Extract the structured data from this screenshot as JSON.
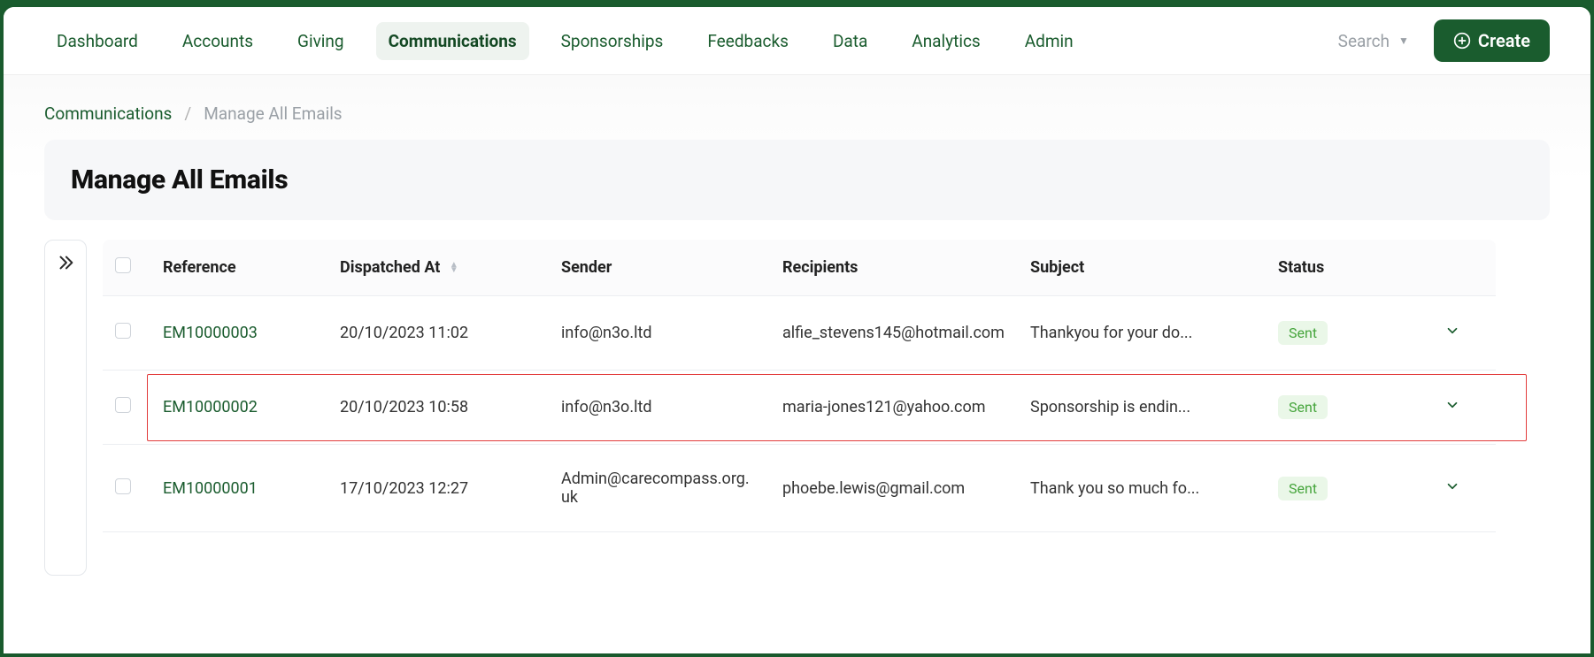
{
  "nav": {
    "items": [
      "Dashboard",
      "Accounts",
      "Giving",
      "Communications",
      "Sponsorships",
      "Feedbacks",
      "Data",
      "Analytics",
      "Admin"
    ],
    "active_index": 3
  },
  "topbar": {
    "search_label": "Search",
    "create_label": "Create"
  },
  "breadcrumb": {
    "root": "Communications",
    "current": "Manage All Emails"
  },
  "page": {
    "title": "Manage All Emails"
  },
  "table": {
    "columns": {
      "reference": "Reference",
      "dispatched_at": "Dispatched At",
      "sender": "Sender",
      "recipients": "Recipients",
      "subject": "Subject",
      "status": "Status"
    },
    "rows": [
      {
        "reference": "EM10000003",
        "dispatched_at": "20/10/2023 11:02",
        "sender": "info@n3o.ltd",
        "recipients": "alfie_stevens145@hotmail.com",
        "subject": "Thankyou for your do...",
        "status": "Sent",
        "highlighted": false
      },
      {
        "reference": "EM10000002",
        "dispatched_at": "20/10/2023 10:58",
        "sender": "info@n3o.ltd",
        "recipients": "maria-jones121@yahoo.com",
        "subject": "Sponsorship is endin...",
        "status": "Sent",
        "highlighted": true
      },
      {
        "reference": "EM10000001",
        "dispatched_at": "17/10/2023 12:27",
        "sender": "Admin@carecompass.org.uk",
        "recipients": "phoebe.lewis@gmail.com",
        "subject": "Thank you so much fo...",
        "status": "Sent",
        "highlighted": false
      }
    ]
  }
}
